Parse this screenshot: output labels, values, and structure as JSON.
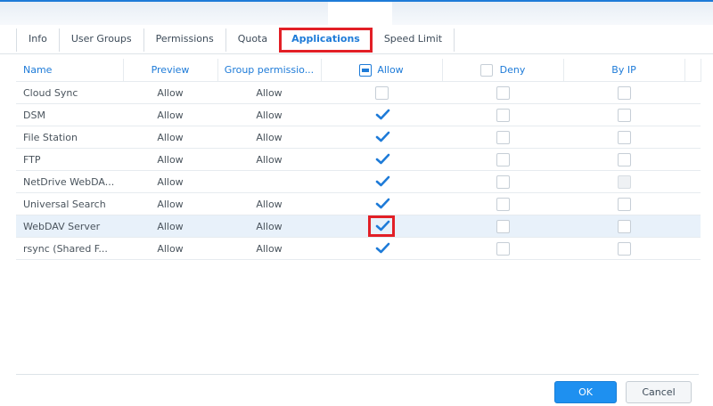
{
  "tabs": [
    {
      "label": "Info"
    },
    {
      "label": "User Groups"
    },
    {
      "label": "Permissions"
    },
    {
      "label": "Quota"
    },
    {
      "label": "Applications"
    },
    {
      "label": "Speed Limit"
    }
  ],
  "table": {
    "headers": {
      "name": "Name",
      "preview": "Preview",
      "group": "Group permissio...",
      "allow": "Allow",
      "deny": "Deny",
      "byip": "By IP"
    },
    "rows": [
      {
        "name": "Cloud Sync",
        "preview": "Allow",
        "group": "Allow",
        "allow": false,
        "deny": false,
        "byip": false,
        "byip_disabled": false
      },
      {
        "name": "DSM",
        "preview": "Allow",
        "group": "Allow",
        "allow": true,
        "deny": false,
        "byip": false,
        "byip_disabled": false
      },
      {
        "name": "File Station",
        "preview": "Allow",
        "group": "Allow",
        "allow": true,
        "deny": false,
        "byip": false,
        "byip_disabled": false
      },
      {
        "name": "FTP",
        "preview": "Allow",
        "group": "Allow",
        "allow": true,
        "deny": false,
        "byip": false,
        "byip_disabled": false
      },
      {
        "name": "NetDrive WebDA...",
        "preview": "Allow",
        "group": "",
        "allow": true,
        "deny": false,
        "byip": false,
        "byip_disabled": true
      },
      {
        "name": "Universal Search",
        "preview": "Allow",
        "group": "Allow",
        "allow": true,
        "deny": false,
        "byip": false,
        "byip_disabled": false
      },
      {
        "name": "WebDAV Server",
        "preview": "Allow",
        "group": "Allow",
        "allow": true,
        "deny": false,
        "byip": false,
        "byip_disabled": false
      },
      {
        "name": "rsync (Shared F...",
        "preview": "Allow",
        "group": "Allow",
        "allow": true,
        "deny": false,
        "byip": false,
        "byip_disabled": false
      }
    ]
  },
  "buttons": {
    "ok": "OK",
    "cancel": "Cancel"
  },
  "colors": {
    "accent": "#1e7bd8",
    "highlight": "#e21f26",
    "selected_row": "#e8f1fa"
  }
}
